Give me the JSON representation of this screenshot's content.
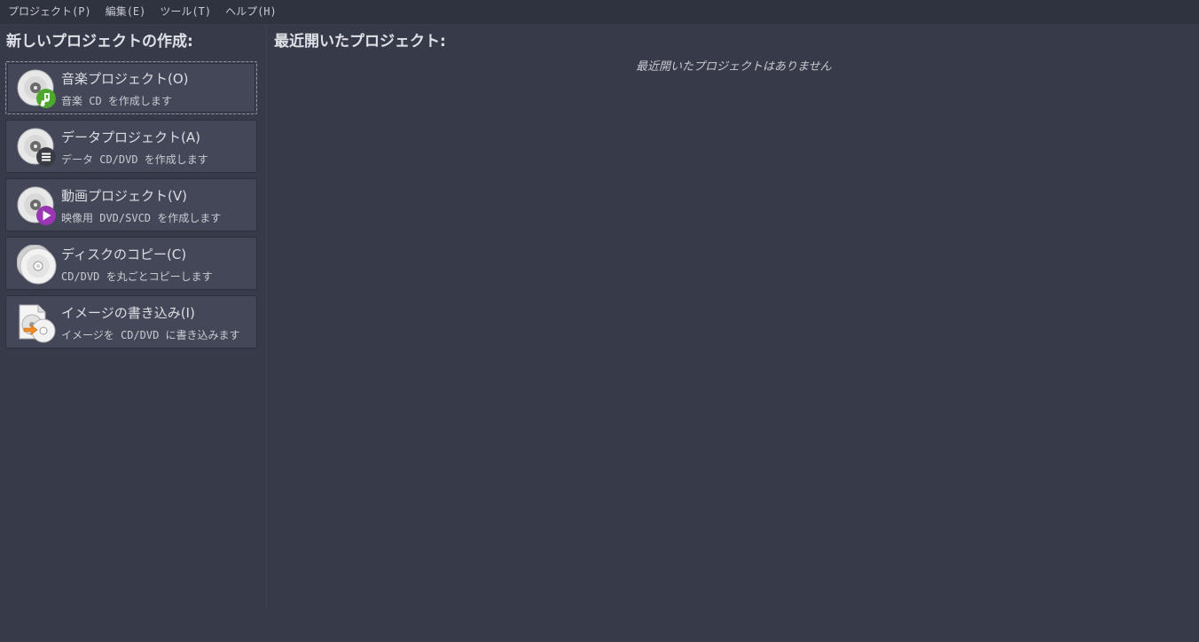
{
  "menubar": {
    "items": [
      "プロジェクト(P)",
      "編集(E)",
      "ツール(T)",
      "ヘルプ(H)"
    ]
  },
  "left": {
    "title": "新しいプロジェクトの作成:",
    "projects": [
      {
        "title": "音楽プロジェクト(O)",
        "desc": "音楽 CD を作成します",
        "icon": "audio-cd-icon",
        "badge_color": "#4fa82e"
      },
      {
        "title": "データプロジェクト(A)",
        "desc": "データ CD/DVD を作成します",
        "icon": "data-cd-icon",
        "badge_color": "#3b3d45"
      },
      {
        "title": "動画プロジェクト(V)",
        "desc": "映像用 DVD/SVCD を作成します",
        "icon": "video-dvd-icon",
        "badge_color": "#9a35b4"
      },
      {
        "title": "ディスクのコピー(C)",
        "desc": "CD/DVD を丸ごとコピーします",
        "icon": "disc-copy-icon"
      },
      {
        "title": "イメージの書き込み(I)",
        "desc": "イメージを CD/DVD に書き込みます",
        "icon": "image-burn-icon",
        "badge_color": "#f08a24"
      }
    ]
  },
  "right": {
    "title": "最近開いたプロジェクト:",
    "empty_message": "最近開いたプロジェクトはありません"
  }
}
